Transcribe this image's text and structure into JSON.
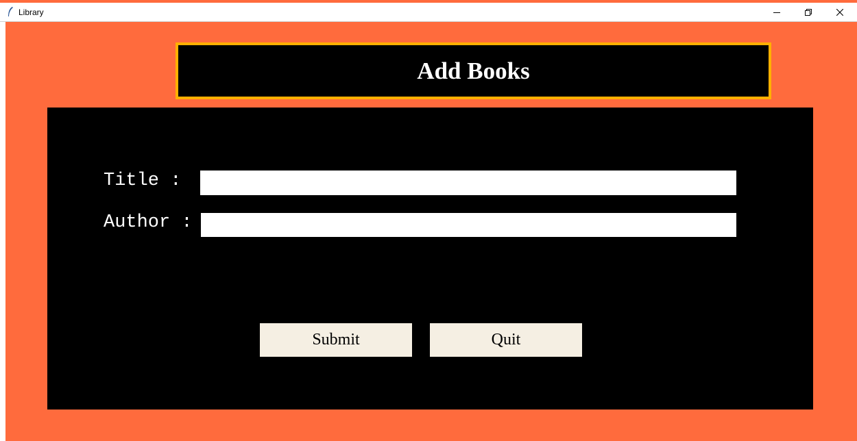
{
  "window": {
    "title": "Library",
    "controls": {
      "minimize": "minimize-icon",
      "maximize": "restore-icon",
      "close": "close-icon"
    }
  },
  "header": {
    "title": "Add Books"
  },
  "form": {
    "title_label": "Title :",
    "title_value": "",
    "author_label": "Author :",
    "author_value": ""
  },
  "buttons": {
    "submit_label": "Submit",
    "quit_label": "Quit"
  },
  "colors": {
    "background": "#ff6b3d",
    "panel": "#000000",
    "heading_border": "#ffb000",
    "button_bg": "#f5efe3",
    "text_light": "#ffffff"
  }
}
